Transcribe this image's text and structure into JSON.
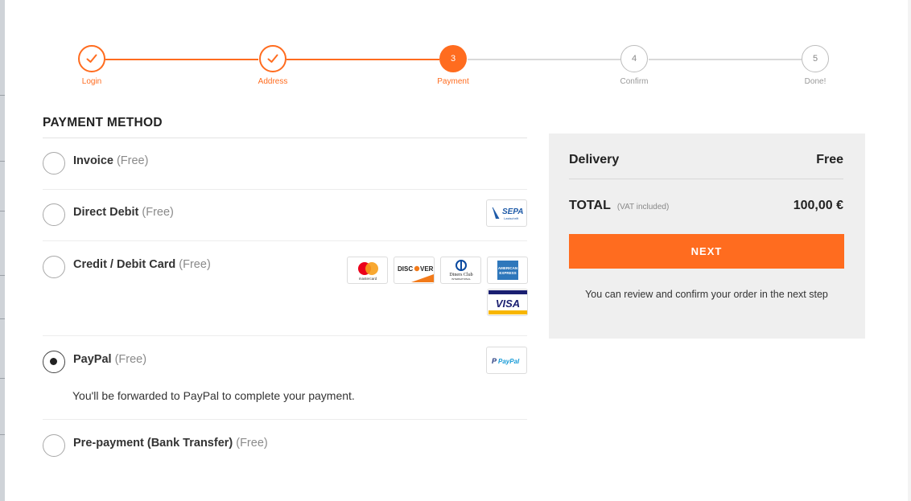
{
  "stepper": {
    "steps": [
      {
        "label": "Login",
        "state": "complete",
        "icon": "check-icon"
      },
      {
        "label": "Address",
        "state": "complete",
        "icon": "check-icon"
      },
      {
        "label": "Payment",
        "state": "current",
        "number": "3"
      },
      {
        "label": "Confirm",
        "state": "future",
        "number": "4"
      },
      {
        "label": "Done!",
        "state": "future",
        "number": "5"
      }
    ]
  },
  "payment": {
    "title": "PAYMENT METHOD",
    "options": [
      {
        "name": "Invoice",
        "fee": "(Free)",
        "selected": false
      },
      {
        "name": "Direct Debit",
        "fee": "(Free)",
        "selected": false,
        "logo": "SEPA"
      },
      {
        "name": "Credit / Debit Card",
        "fee": "(Free)",
        "selected": false,
        "logos": [
          "mastercard",
          "DISCOVER",
          "Diners Club",
          "AMERICAN EXPRESS",
          "VISA"
        ]
      },
      {
        "name": "PayPal",
        "fee": "(Free)",
        "selected": true,
        "logo": "PayPal",
        "note": "You'll be forwarded to PayPal to complete your payment."
      },
      {
        "name": "Pre-payment (Bank Transfer)",
        "fee": "(Free)",
        "selected": false
      }
    ],
    "logo_text": {
      "sepa": "SEPA",
      "sepa_sub": "Lastschrift",
      "mastercard": "mastercard",
      "discover": "DISC",
      "discover_tail": "VER",
      "diners": "Diners Club",
      "diners_sub": "INTERNATIONAL",
      "amex_1": "AMERICAN",
      "amex_2": "EXPRESS",
      "visa": "VISA",
      "paypal": "PayPal"
    }
  },
  "summary": {
    "delivery_label": "Delivery",
    "delivery_value": "Free",
    "total_label": "TOTAL",
    "vat_note": "(VAT included)",
    "total_value": "100,00 €",
    "next_label": "NEXT",
    "note": "You can review and confirm your order in the next step"
  },
  "colors": {
    "accent": "#ff6c1f",
    "summary_bg": "#efefef",
    "inactive": "#d9d9d9"
  }
}
